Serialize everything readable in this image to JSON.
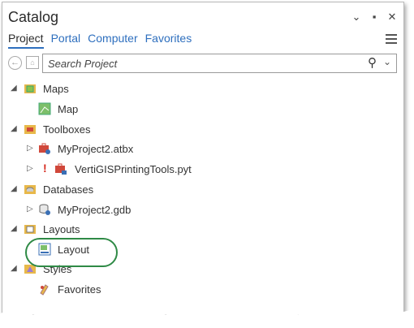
{
  "window": {
    "title": "Catalog",
    "controls": [
      "⌄",
      "▪",
      "✕"
    ]
  },
  "tabs": [
    {
      "label": "Project",
      "active": true
    },
    {
      "label": "Portal",
      "active": false
    },
    {
      "label": "Computer",
      "active": false
    },
    {
      "label": "Favorites",
      "active": false
    }
  ],
  "search": {
    "placeholder": "Search Project"
  },
  "tree": {
    "maps": "Maps",
    "map": "Map",
    "toolboxes": "Toolboxes",
    "myproject_atbx": "MyProject2.atbx",
    "verti_pyt": "VertiGISPrintingTools.pyt",
    "verti_warning": "!",
    "databases": "Databases",
    "myproject_gdb": "MyProject2.gdb",
    "layouts": "Layouts",
    "layout": "Layout",
    "styles": "Styles",
    "favorites": "Favorites"
  },
  "colors": {
    "accent": "#2e6fbe",
    "folder": "#e8b84a",
    "highlight": "#2f8a46",
    "warning": "#d62a1f"
  }
}
